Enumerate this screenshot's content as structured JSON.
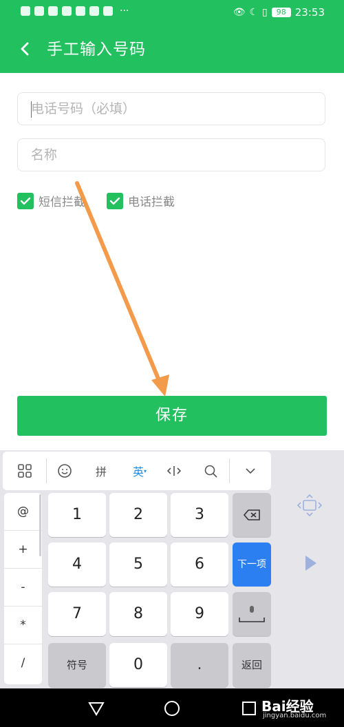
{
  "status_bar": {
    "battery": "98",
    "time": "23:53",
    "overflow": "···"
  },
  "app_bar": {
    "title": "手工输入号码"
  },
  "form": {
    "phone_placeholder": "电话号码（必填）",
    "name_placeholder": "名称",
    "sms_block_label": "短信拦截",
    "call_block_label": "电话拦截",
    "save_label": "保存"
  },
  "keyboard": {
    "toolbar": {
      "pinyin": "拼",
      "english": "英"
    },
    "symbols": [
      "@",
      "+",
      "-",
      "*",
      "/"
    ],
    "digits": [
      "1",
      "2",
      "3",
      "4",
      "5",
      "6",
      "7",
      "8",
      "9",
      "0"
    ],
    "symbol_key": "符号",
    "dot_key": ".",
    "next_key": "下一项",
    "return_key": "返回"
  },
  "watermark": {
    "logo": "Bai经验",
    "sub": "jingyan.baidu.com"
  },
  "colors": {
    "primary": "#22c05f",
    "next_key": "#2c7ff0",
    "arrow": "#f39a4b"
  }
}
